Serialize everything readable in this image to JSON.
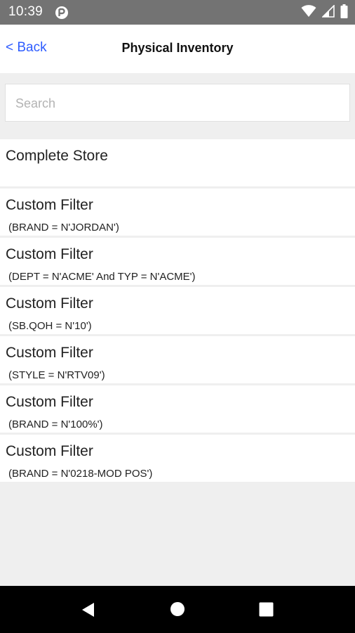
{
  "status_bar": {
    "time": "10:39",
    "icons": [
      "app-notification-icon",
      "wifi-icon",
      "cell-signal-icon",
      "battery-icon"
    ]
  },
  "header": {
    "back_label": "< Back",
    "title": "Physical Inventory"
  },
  "search": {
    "placeholder": "Search",
    "value": ""
  },
  "list": {
    "complete_store": "Complete Store",
    "filters": [
      {
        "title": "Custom Filter",
        "subtitle": "(BRAND = N'JORDAN')"
      },
      {
        "title": "Custom Filter",
        "subtitle": "(DEPT = N'ACME' And TYP = N'ACME')"
      },
      {
        "title": "Custom Filter",
        "subtitle": "(SB.QOH = N'10')"
      },
      {
        "title": "Custom Filter",
        "subtitle": "(STYLE = N'RTV09')"
      },
      {
        "title": "Custom Filter",
        "subtitle": "(BRAND = N'100%')"
      },
      {
        "title": "Custom Filter",
        "subtitle": "(BRAND = N'0218-MOD POS')"
      }
    ]
  },
  "system_nav": {
    "icons": [
      "back-triangle-icon",
      "home-circle-icon",
      "recents-square-icon"
    ]
  },
  "colors": {
    "status_bar": "#737373",
    "link_accent": "#2e5cff",
    "background": "#efefef",
    "nav_bar": "#000000"
  }
}
